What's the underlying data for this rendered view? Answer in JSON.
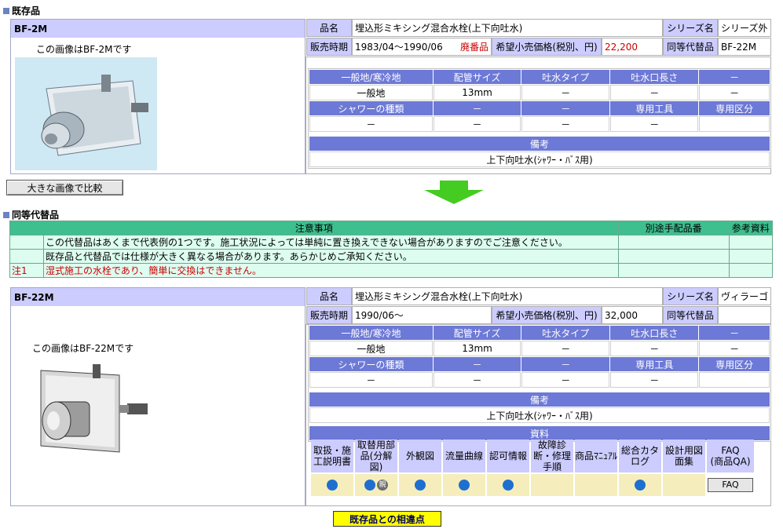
{
  "existing": {
    "section_title": "既存品",
    "model": "BF-2M",
    "caption": "この画像はBF-2Mです",
    "name_label": "品名",
    "name_value": "埋込形ミキシング混合水栓(上下向吐水)",
    "series_label": "シリーズ名",
    "series_value": "シリーズ外",
    "period_label": "販売時期",
    "period_value": "1983/04～1990/06",
    "discontinued": "廃番品",
    "price_label": "希望小売価格(税別、円)",
    "price_value": "22,200",
    "equiv_label": "同等代替品",
    "equiv_value": "BF-22M",
    "spec_headers1": [
      "一般地/寒冷地",
      "配管サイズ",
      "吐水タイプ",
      "吐水口長さ",
      "－"
    ],
    "spec_values1": [
      "一般地",
      "13mm",
      "－",
      "－",
      "－"
    ],
    "spec_headers2": [
      "シャワーの種類",
      "－",
      "－",
      "専用工具",
      "専用区分"
    ],
    "spec_values2": [
      "－",
      "－",
      "－",
      "－",
      ""
    ],
    "remarks_label": "備考",
    "remarks_value": "上下向吐水(ｼｬﾜｰ・ﾊﾞｽ用)",
    "compare_button": "大きな画像で比較"
  },
  "replacement": {
    "section_title": "同等代替品",
    "notes_headers": [
      "注意事項",
      "別途手配品番",
      "参考資料"
    ],
    "notes": [
      {
        "mark": "",
        "text": "この代替品はあくまで代表例の1つです。施工状況によっては単純に置き換えできない場合がありますのでご注意ください。"
      },
      {
        "mark": "",
        "text": "既存品と代替品では仕様が大きく異なる場合があります。あらかじめご承知ください。"
      },
      {
        "mark": "注1",
        "text": "湿式施工の水栓であり、簡単に交換はできません。"
      }
    ],
    "model": "BF-22M",
    "caption": "この画像はBF-22Mです",
    "name_label": "品名",
    "name_value": "埋込形ミキシング混合水栓(上下向吐水)",
    "series_label": "シリーズ名",
    "series_value": "ヴィラーゴ",
    "period_label": "販売時期",
    "period_value": "1990/06～",
    "price_label": "希望小売価格(税別、円)",
    "price_value": "32,000",
    "equiv_label": "同等代替品",
    "equiv_value": "",
    "spec_headers1": [
      "一般地/寒冷地",
      "配管サイズ",
      "吐水タイプ",
      "吐水口長さ",
      "－"
    ],
    "spec_values1": [
      "一般地",
      "13mm",
      "－",
      "－",
      "－"
    ],
    "spec_headers2": [
      "シャワーの種類",
      "－",
      "－",
      "専用工具",
      "専用区分"
    ],
    "spec_values2": [
      "－",
      "－",
      "－",
      "－",
      ""
    ],
    "remarks_label": "備考",
    "remarks_value": "上下向吐水(ｼｬﾜｰ・ﾊﾞｽ用)",
    "docs_label": "資料",
    "docs": [
      {
        "label": "取扱・施工説明書",
        "has": true,
        "oya": false
      },
      {
        "label": "取替用部品(分解図)",
        "has": true,
        "oya": true,
        "oya_text": "親"
      },
      {
        "label": "外観図",
        "has": true,
        "oya": false
      },
      {
        "label": "流量曲線",
        "has": true,
        "oya": false
      },
      {
        "label": "認可情報",
        "has": true,
        "oya": false
      },
      {
        "label": "故障診断・修理手順",
        "has": false,
        "oya": false
      },
      {
        "label": "商品ﾏﾆｭｱﾙ",
        "has": false,
        "oya": false
      },
      {
        "label": "総合カタログ",
        "has": true,
        "oya": false
      },
      {
        "label": "設計用図面集",
        "has": false,
        "oya": false
      }
    ],
    "faq_header": "FAQ\n(商品QA)",
    "faq_button": "FAQ"
  },
  "diff_button": "既存品との相違点",
  "colors": {
    "header_blue": "#6d79d6",
    "label_lavender": "#ccccff",
    "notes_green": "#3fbf8f",
    "arrow_green": "#44cc22"
  }
}
